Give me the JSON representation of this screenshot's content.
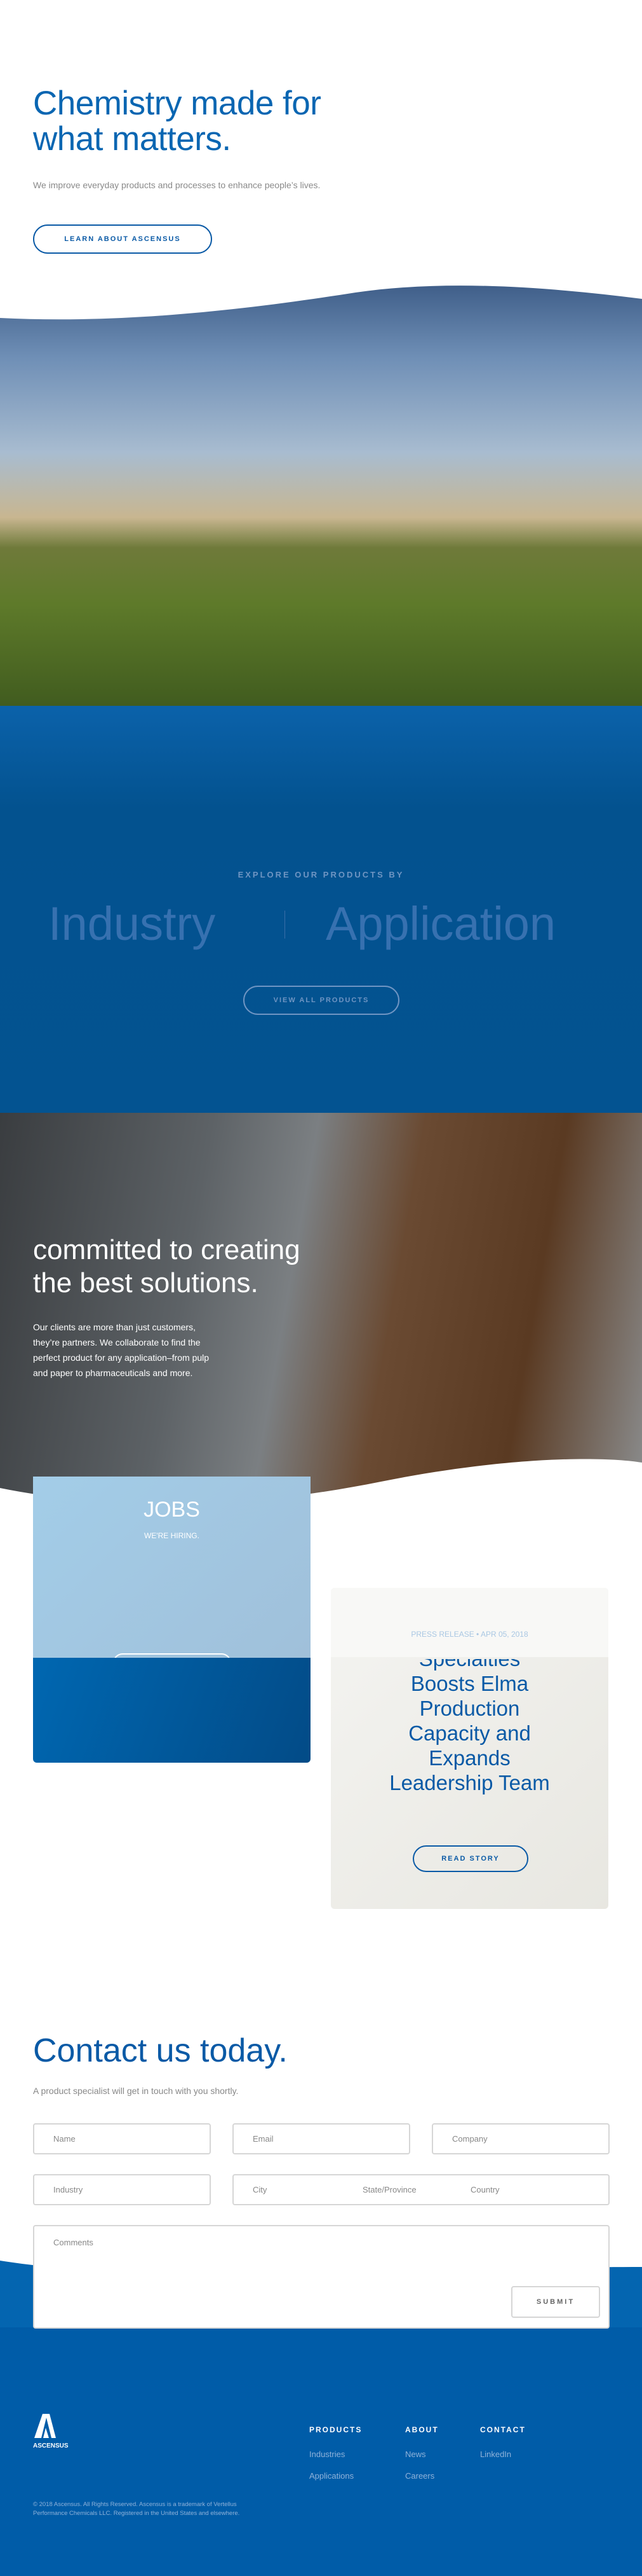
{
  "hero": {
    "title_line1": "Chemistry made for",
    "title_line2": "what matters.",
    "subtitle": "We improve everyday products and processes to enhance people’s lives.",
    "cta": "LEARN ABOUT ASCENSUS"
  },
  "products": {
    "eyebrow": "EXPLORE OUR PRODUCTS BY",
    "industry": "Industry",
    "application": "Application",
    "cta": "VIEW ALL PRODUCTS"
  },
  "partner": {
    "title_line1": "committed to creating",
    "title_line2": "the best solutions.",
    "body": [
      "Our clients are more than just customers,",
      "they’re partners. We collaborate to find the",
      "perfect product for any application–from pulp",
      "and paper to pharmaceuticals and more."
    ]
  },
  "jobs": {
    "title": "JOBS",
    "subtitle": "WE'RE HIRING."
  },
  "press": {
    "category": "PRESS RELEASE",
    "date": "APR 05, 2018",
    "headline": [
      "Specialties",
      "Boosts Elma",
      "Production",
      "Capacity and",
      "Expands",
      "Leadership Team"
    ],
    "cta": "READ STORY"
  },
  "contact": {
    "title": "Contact us today.",
    "subtitle": "A product specialist will get in touch with you shortly.",
    "fields": {
      "name": "Name",
      "email": "Email",
      "company": "Company",
      "industry": "Industry",
      "city": "City",
      "state": "State/Province",
      "country": "Country",
      "comments": "Comments"
    },
    "submit": "SUBMIT"
  },
  "footer": {
    "logo": "ASCENSUS",
    "columns": [
      {
        "heading": "PRODUCTS",
        "links": [
          "Industries",
          "Applications"
        ]
      },
      {
        "heading": "ABOUT",
        "links": [
          "News",
          "Careers"
        ]
      },
      {
        "heading": "CONTACT",
        "links": [
          "LinkedIn"
        ]
      }
    ],
    "copyright_line1": "© 2018 Ascensus. All Rights Reserved. Ascensus is a trademark of Vertellus",
    "copyright_line2": "Performance Chemicals LLC. Registered in the United States and elsewhere."
  },
  "colors": {
    "brand": "#0a66b2",
    "footer": "#005ca8"
  }
}
